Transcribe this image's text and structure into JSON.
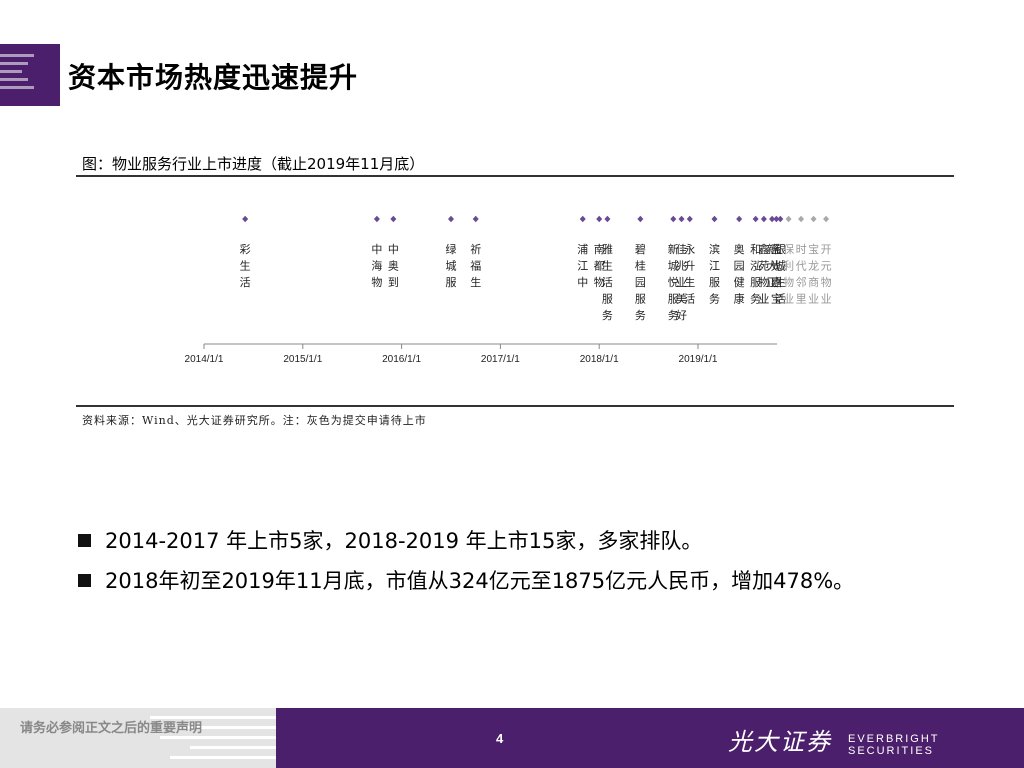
{
  "header": {
    "title": "资本市场热度迅速提升"
  },
  "figure": {
    "caption": "图：物业服务行业上市进度（截止2019年11月底）",
    "source": "资料来源：Wind、光大证券研究所。注：灰色为提交申请待上市"
  },
  "chart_data": {
    "type": "scatter",
    "x_ticks": [
      "2014/1/1",
      "2015/1/1",
      "2016/1/1",
      "2017/1/1",
      "2018/1/1",
      "2019/1/1"
    ],
    "colors": {
      "listed": "#6a4a94",
      "pending": "#a9a9a9",
      "axis": "#888888"
    },
    "points": [
      {
        "date": "2014-06",
        "label": "彩生活",
        "status": "listed"
      },
      {
        "date": "2015-10",
        "label": "中海物",
        "status": "listed"
      },
      {
        "date": "2015-12",
        "label": "中奥到",
        "status": "listed"
      },
      {
        "date": "2016-07",
        "label": "绿城服",
        "status": "listed"
      },
      {
        "date": "2016-10",
        "label": "祈福生",
        "status": "listed"
      },
      {
        "date": "2017-11",
        "label": "浦江中",
        "status": "listed"
      },
      {
        "date": "2018-01",
        "label": "南都物",
        "status": "listed"
      },
      {
        "date": "2018-02",
        "label": "雅生活服务",
        "status": "listed"
      },
      {
        "date": "2018-06",
        "label": "碧桂园服务",
        "status": "listed"
      },
      {
        "date": "2018-10",
        "label": "新城悦服务",
        "status": "listed"
      },
      {
        "date": "2018-11",
        "label": "佳兆业美好",
        "status": "listed"
      },
      {
        "date": "2018-12",
        "label": "永升生活",
        "status": "listed"
      },
      {
        "date": "2019-03",
        "label": "滨江服务",
        "status": "listed"
      },
      {
        "date": "2019-06",
        "label": "奥园健康",
        "status": "listed"
      },
      {
        "date": "2019-08",
        "label": "和泓服务",
        "status": "listed"
      },
      {
        "date": "2019-09",
        "label": "鑫苑物业",
        "status": "listed"
      },
      {
        "date": "2019-09",
        "label": "蓝光嘉宝",
        "status": "listed"
      },
      {
        "date": "2019-10",
        "label": "新大正",
        "status": "listed"
      },
      {
        "date": "2019-11",
        "label": "银城生活",
        "status": "listed"
      },
      {
        "date": "2019-12",
        "label": "保利物业",
        "status": "pending"
      },
      {
        "date": "2019-12",
        "label": "时代邻里",
        "status": "pending"
      },
      {
        "date": "2019-12",
        "label": "宝龙商业",
        "status": "pending"
      },
      {
        "date": "2019-12",
        "label": "开元物业",
        "status": "pending"
      }
    ]
  },
  "bullets": [
    "2014-2017 年上市5家，2018-2019 年上市15家，多家排队。",
    "2018年初至2019年11月底，市值从324亿元至1875亿元人民币，增加478%。"
  ],
  "footer": {
    "disclaimer": "请务必参阅正文之后的重要声明",
    "page_number": "4",
    "brand_cn": "光大证券",
    "brand_en": "EVERBRIGHT SECURITIES"
  }
}
